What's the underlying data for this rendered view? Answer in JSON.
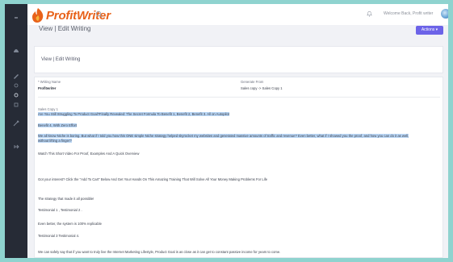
{
  "brand": {
    "name": "ProfitWriter",
    "color": "#e8621a"
  },
  "header": {
    "welcome": "Welcome Back, Profit writer"
  },
  "page": {
    "title": "View | Edit Writing",
    "actions_label": "Actions ▾"
  },
  "card": {
    "title": "View | Edit Writing"
  },
  "fields": {
    "writing_name_label": "* Writing Name",
    "writing_name_value": "Profitwriter",
    "generate_from_label": "Generate From",
    "generate_from_value": "Sales copy -> Sales Copy 1"
  },
  "content": {
    "section_label": "Sales Copy 1",
    "headline": "Are You Still Struggling To Product Goal?Finally Revealed: The Secret Formula To Benefit 1, Benefit 2, Benefit 3. All on Autopilot",
    "benefit_line": "Benefit 4, With Zero Effort",
    "para_line1": "We all know Niche is boring. But what if I told you how this ONE simple Niche strategy helped skyrocket my websites and generated massive amounts of traffic and revenue? Even better, what if I showed you the proof, and how you can do it as well,",
    "para_line2": "without lifting a finger?",
    "video_line": "Watch This Short Video For Proof, Examples And A Quick Overview",
    "interest_line": "Got your interest? Click the \"Add To Cart\" Below And Get Your Hands On This Amazing Training That Will Solve All Your Money Making Problems For Life",
    "strategy_line": "The strategy that made it all possible!",
    "testimonial_12": "Testimonial 1 , Testimonial 2 .",
    "replicable_line": "Even better, the system is 100% replicable",
    "testimonial_34": "Testimonial 3 Testimonial 4.",
    "lifestyle_line": "We can safely say that if you want to truly live the Internet Marketing Lifestyle, Product Goal is as close as it can get to constant passive income for years to come."
  },
  "colors": {
    "sidebar": "#262b36",
    "accent": "#6c63e8",
    "highlight": "#b9d6f5",
    "background": "#8fd3cf"
  }
}
